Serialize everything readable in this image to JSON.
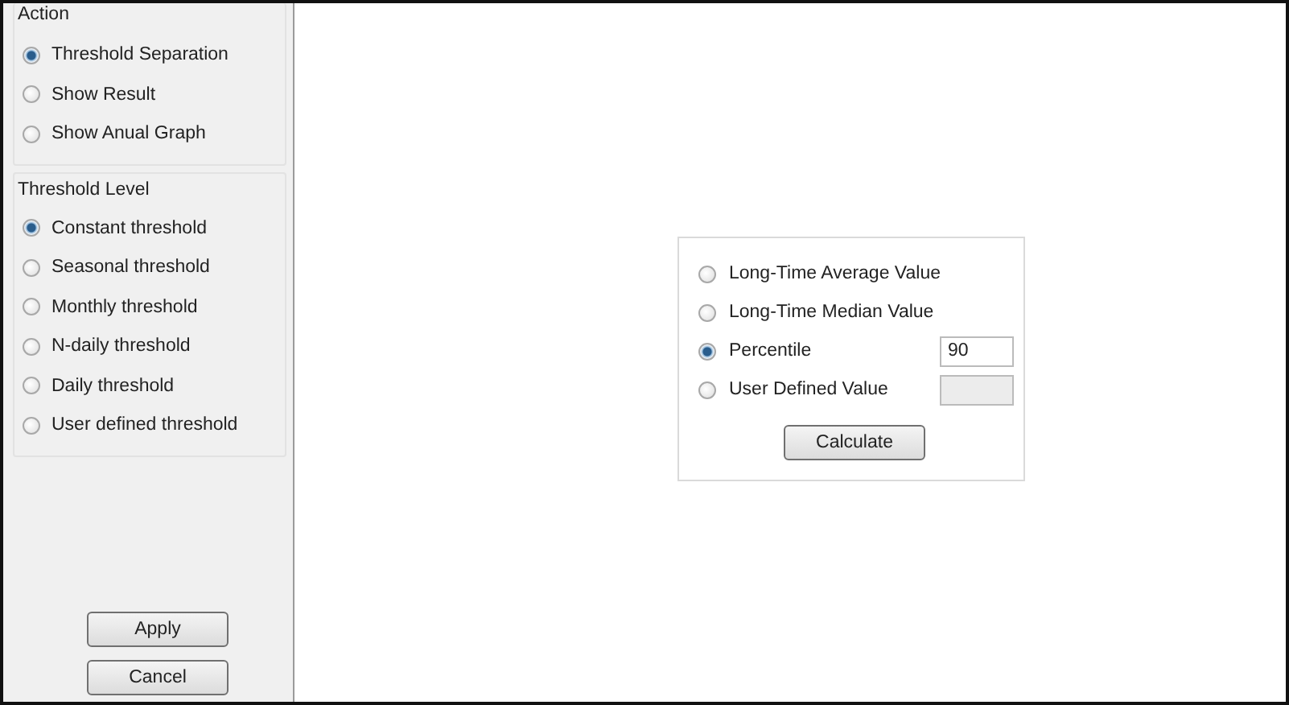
{
  "action": {
    "title": "Action",
    "options": [
      {
        "label": "Threshold Separation",
        "selected": true
      },
      {
        "label": "Show Result",
        "selected": false
      },
      {
        "label": "Show Anual Graph",
        "selected": false
      }
    ]
  },
  "threshold_level": {
    "title": "Threshold Level",
    "options": [
      {
        "label": "Constant threshold",
        "selected": true
      },
      {
        "label": "Seasonal threshold",
        "selected": false
      },
      {
        "label": "Monthly threshold",
        "selected": false
      },
      {
        "label": "N-daily threshold",
        "selected": false
      },
      {
        "label": "Daily threshold",
        "selected": false
      },
      {
        "label": "User defined threshold",
        "selected": false
      }
    ]
  },
  "buttons": [
    "Apply",
    "Cancel"
  ],
  "value_options": [
    {
      "label": "Long-Time Average Value",
      "selected": false
    },
    {
      "label": "Long-Time Median Value",
      "selected": false
    },
    {
      "label": "Percentile",
      "selected": true,
      "field": {
        "value": "90",
        "disabled": false
      }
    },
    {
      "label": "User Defined Value",
      "selected": false,
      "field": {
        "disabled": true
      }
    }
  ],
  "calculate_button": "Calculate"
}
